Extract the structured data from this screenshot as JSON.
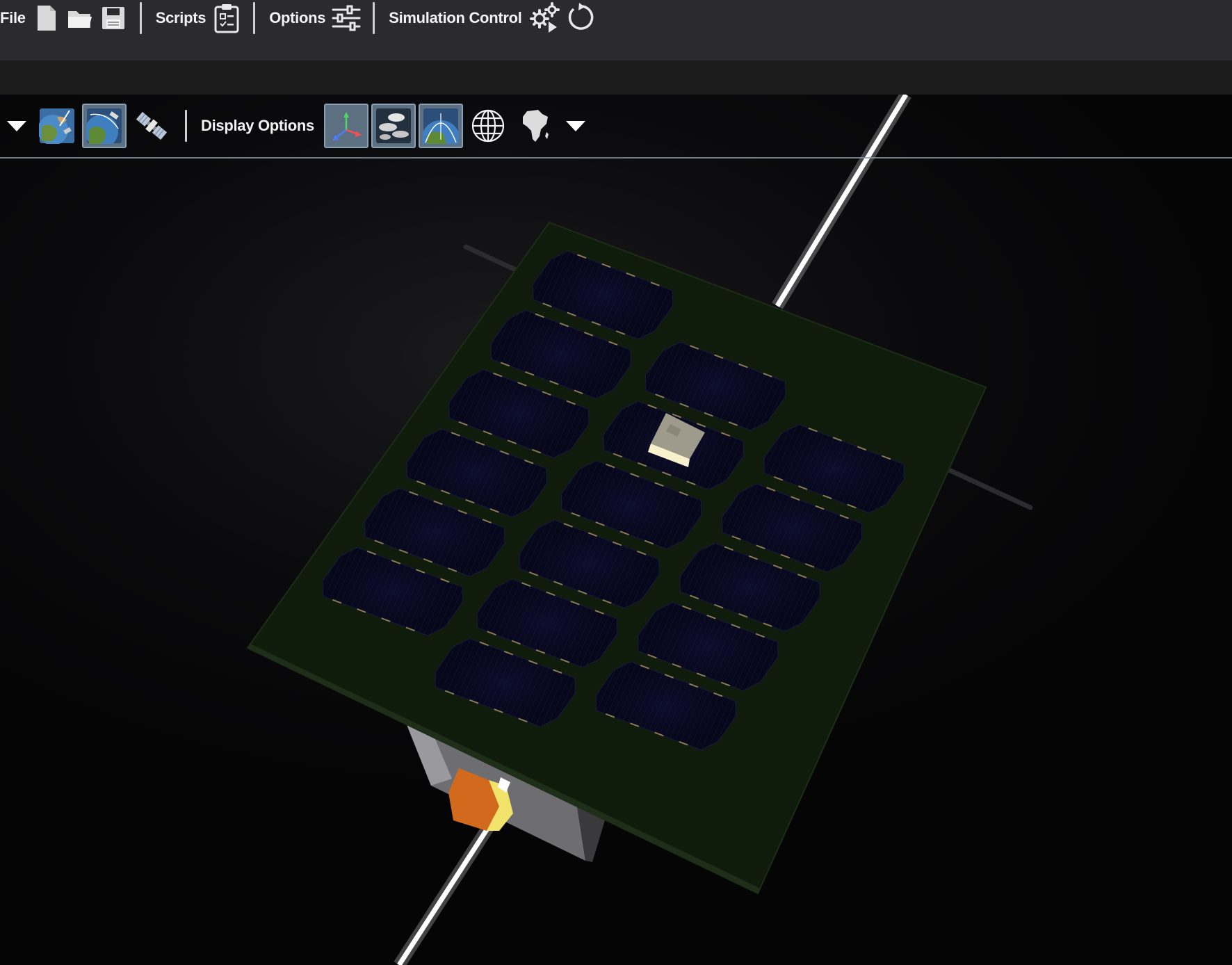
{
  "menubar": {
    "file_label": "File",
    "scripts_label": "Scripts",
    "options_label": "Options",
    "simulation_label": "Simulation Control"
  },
  "display_toolbar": {
    "display_options_label": "Display Options",
    "active_view": "earth-orbit-view",
    "active_toggles": [
      "axes",
      "clouds",
      "atmosphere"
    ]
  },
  "icons": {
    "file": [
      "new-file-icon",
      "open-folder-icon",
      "save-floppy-icon"
    ],
    "scripts": "clipboard-checklist-icon",
    "options": "sliders-icon",
    "simulation": [
      "gears-play-icon",
      "reset-icon"
    ],
    "views": [
      "satellite-earth-view-icon",
      "earth-orbit-view-icon",
      "satellite-icon"
    ],
    "display": [
      "axes-icon",
      "clouds-icon",
      "atmosphere-icon",
      "globe-grid-icon",
      "africa-continent-icon"
    ]
  },
  "colors": {
    "menubar_bg": "#2b2b2d",
    "toolbar_active": "#5d7081",
    "panel_green": "#0f1c0b",
    "solar_cell": "#0a0a22"
  }
}
